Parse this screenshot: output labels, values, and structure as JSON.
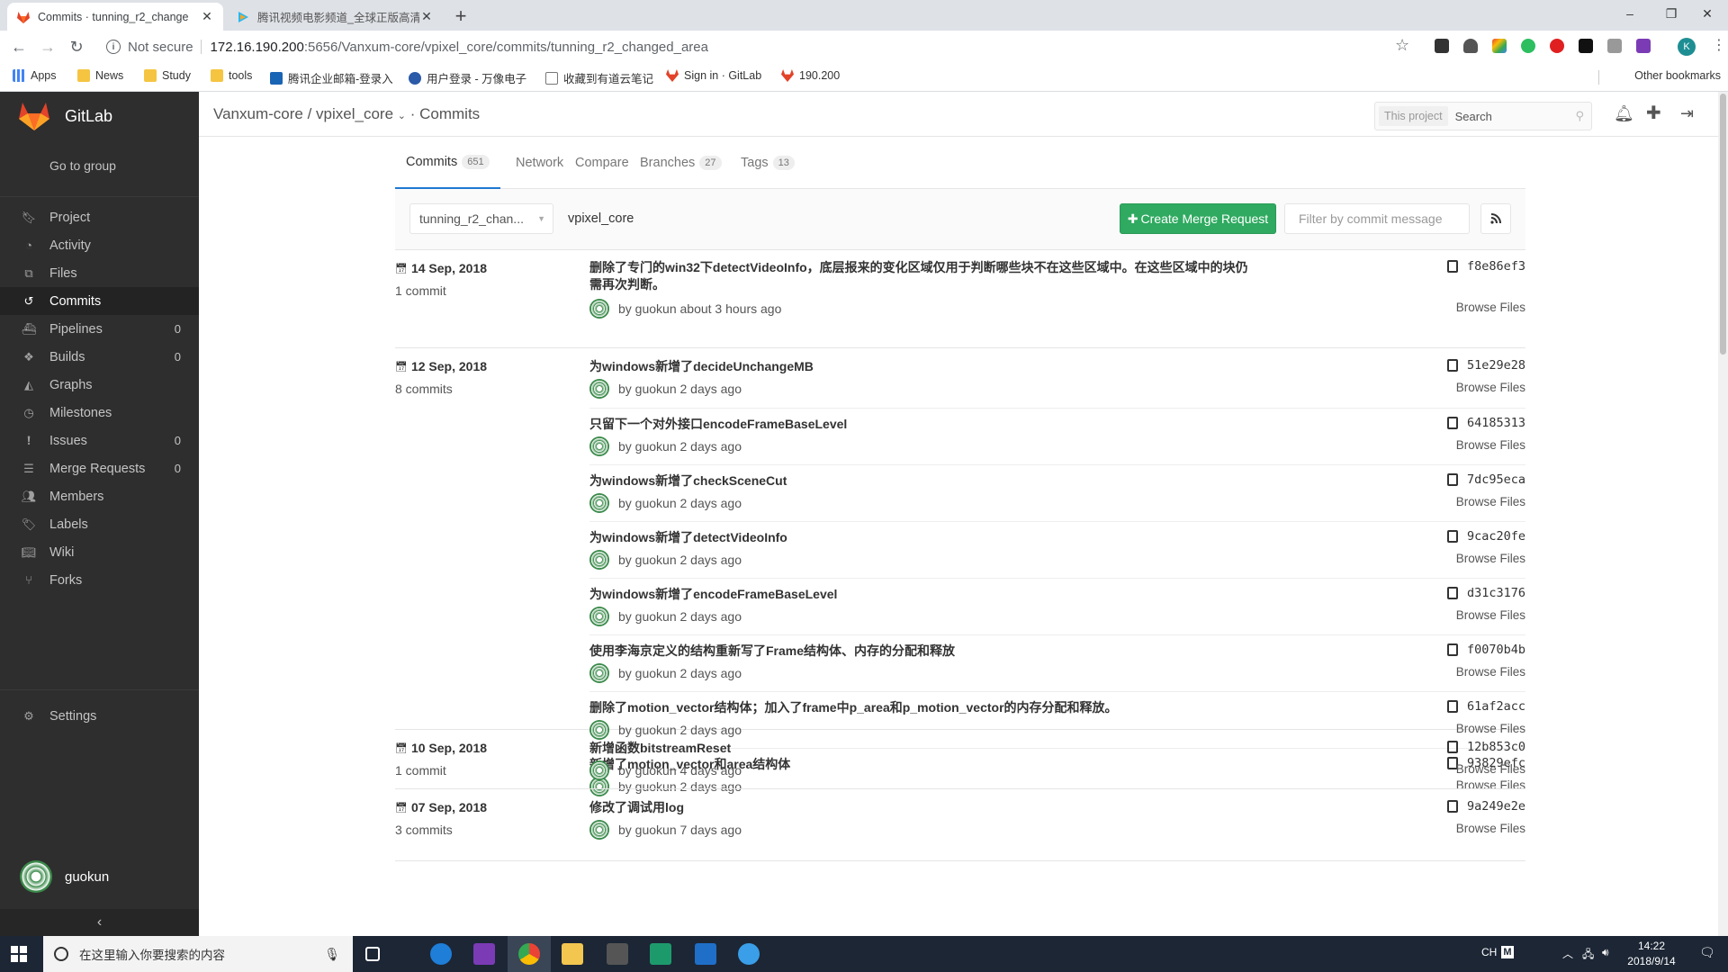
{
  "browser": {
    "tabs": [
      {
        "title": "Commits · tunning_r2_change"
      },
      {
        "title": "腾讯视频电影频道_全球正版高清"
      }
    ],
    "url_security": "Not secure",
    "url_host": "172.16.190.200",
    "url_path": ":5656/Vanxum-core/vpixel_core/commits/tunning_r2_changed_area",
    "profile_initial": "K",
    "bookmarks": [
      "Apps",
      "News",
      "Study",
      "tools",
      "腾讯企业邮箱-登录入",
      "用户登录 - 万像电子",
      "收藏到有道云笔记",
      "Sign in · GitLab",
      "190.200"
    ],
    "other_bookmarks": "Other bookmarks"
  },
  "sidebar": {
    "brand": "GitLab",
    "go_to_group": "Go to group",
    "items": [
      {
        "label": "Project",
        "icon": "bookmark-icon",
        "count": ""
      },
      {
        "label": "Activity",
        "icon": "tachometer-icon",
        "count": ""
      },
      {
        "label": "Files",
        "icon": "files-icon",
        "count": ""
      },
      {
        "label": "Commits",
        "icon": "history-icon",
        "count": ""
      },
      {
        "label": "Pipelines",
        "icon": "ship-icon",
        "count": "0"
      },
      {
        "label": "Builds",
        "icon": "cubes-icon",
        "count": "0"
      },
      {
        "label": "Graphs",
        "icon": "area-chart-icon",
        "count": ""
      },
      {
        "label": "Milestones",
        "icon": "clock-icon",
        "count": ""
      },
      {
        "label": "Issues",
        "icon": "exclamation-circle-icon",
        "count": "0"
      },
      {
        "label": "Merge Requests",
        "icon": "tasks-icon",
        "count": "0"
      },
      {
        "label": "Members",
        "icon": "users-icon",
        "count": ""
      },
      {
        "label": "Labels",
        "icon": "tags-icon",
        "count": ""
      },
      {
        "label": "Wiki",
        "icon": "book-icon",
        "count": ""
      },
      {
        "label": "Forks",
        "icon": "code-fork-icon",
        "count": ""
      }
    ],
    "settings": "Settings",
    "user": "guokun",
    "collapse": "‹"
  },
  "header": {
    "group": "Vanxum-core",
    "slash": "/",
    "project": "vpixel_core",
    "section": "· Commits",
    "search_scope": "This project",
    "search_placeholder": "Search"
  },
  "tabs": [
    {
      "label": "Commits",
      "count": "651"
    },
    {
      "label": "Network",
      "count": ""
    },
    {
      "label": "Compare",
      "count": ""
    },
    {
      "label": "Branches",
      "count": "27"
    },
    {
      "label": "Tags",
      "count": "13"
    }
  ],
  "filter": {
    "branch": "tunning_r2_chan...",
    "project": "vpixel_core",
    "create_mr": "Create Merge Request",
    "filter_placeholder": "Filter by commit message"
  },
  "browse_label": "Browse Files",
  "groups": [
    {
      "date": "14 Sep, 2018",
      "count": "1 commit",
      "commits": [
        {
          "message": "删除了专门的win32下detectVideoInfo，底层报来的变化区域仅用于判断哪些块不在这些区域中。在这些区域中的块仍需再次判断。",
          "author": "by guokun",
          "time": "about 3 hours ago",
          "sha": "f8e86ef3"
        }
      ]
    },
    {
      "date": "12 Sep, 2018",
      "count": "8 commits",
      "commits": [
        {
          "message": "为windows新增了decideUnchangeMB",
          "author": "by guokun",
          "time": "2 days ago",
          "sha": "51e29e28"
        },
        {
          "message": "只留下一个对外接口encodeFrameBaseLevel",
          "author": "by guokun",
          "time": "2 days ago",
          "sha": "64185313"
        },
        {
          "message": "为windows新增了checkSceneCut",
          "author": "by guokun",
          "time": "2 days ago",
          "sha": "7dc95eca"
        },
        {
          "message": "为windows新增了detectVideoInfo",
          "author": "by guokun",
          "time": "2 days ago",
          "sha": "9cac20fe"
        },
        {
          "message": "为windows新增了encodeFrameBaseLevel",
          "author": "by guokun",
          "time": "2 days ago",
          "sha": "d31c3176"
        },
        {
          "message": "使用李海京定义的结构重新写了Frame结构体、内存的分配和释放",
          "author": "by guokun",
          "time": "2 days ago",
          "sha": "f0070b4b"
        },
        {
          "message": "删除了motion_vector结构体；加入了frame中p_area和p_motion_vector的内存分配和释放。",
          "author": "by guokun",
          "time": "2 days ago",
          "sha": "61af2acc"
        },
        {
          "message": "新增了motion_vector和area结构体",
          "author": "by guokun",
          "time": "2 days ago",
          "sha": "93829efc"
        }
      ]
    },
    {
      "date": "10 Sep, 2018",
      "count": "1 commit",
      "commits": [
        {
          "message": "新增函数bitstreamReset",
          "author": "by guokun",
          "time": "4 days ago",
          "sha": "12b853c0"
        }
      ]
    },
    {
      "date": "07 Sep, 2018",
      "count": "3 commits",
      "commits": [
        {
          "message": "修改了调试用log",
          "author": "by guokun",
          "time": "7 days ago",
          "sha": "9a249e2e"
        }
      ]
    }
  ],
  "taskbar": {
    "search_placeholder": "在这里输入你要搜索的内容",
    "ime": "CH",
    "time": "14:22",
    "date": "2018/9/14"
  },
  "colors": {
    "sidebar": "#2e2e2e",
    "create_mr": "#2faa60",
    "active_tab_underline": "#1f78d1"
  }
}
